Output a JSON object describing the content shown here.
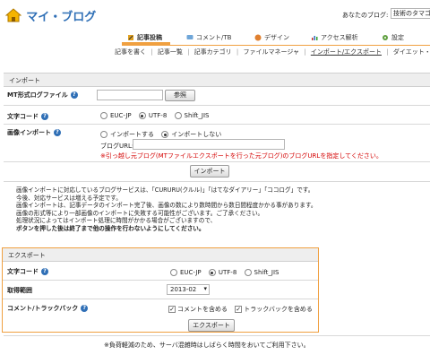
{
  "header": {
    "logo_text": "マイ・ブログ",
    "blog_label": "あなたのブログ:",
    "blog_select": "技術のタマゴ"
  },
  "top_nav": [
    {
      "label": "記事投稿",
      "icon": "pencil-icon"
    },
    {
      "label": "コメント/TB",
      "icon": "comment-icon"
    },
    {
      "label": "デザイン",
      "icon": "design-icon"
    },
    {
      "label": "アクセス解析",
      "icon": "chart-icon"
    },
    {
      "label": "設定",
      "icon": "settings-icon"
    }
  ],
  "sub_nav": [
    "記事を書く",
    "記事一覧",
    "記事カテゴリ",
    "ファイルマネージャ",
    "インポート/エクスポート",
    "ダイエット・ロ"
  ],
  "import": {
    "title": "インポート",
    "mt_label": "MT形式ログファイル",
    "browse_button": "参照",
    "charset_label": "文字コード",
    "charset_options": [
      "EUC-JP",
      "UTF-8",
      "Shift_JIS"
    ],
    "charset_selected": 1,
    "image_label": "画像インポート",
    "image_options": [
      "インポートする",
      "インポートしない"
    ],
    "image_selected": 1,
    "blog_url_label": "ブログURL:",
    "blog_url_note": "※引っ越し元ブログ(MTファイルエクスポートを行った元ブログ)のブログURLを指定してください。",
    "import_button": "インポート",
    "notes": [
      "画像インポートに対応しているブログサービスは、「CURURU(クルル)」「はてなダイアリー」「ココログ」です。",
      "今後、対応サービスは増える予定です。",
      "画像インポートは、記事データのインポート完了後、画像の数により数時間から数日間程度かかる事があります。",
      "画像の形式等により一部画像のインポートに失敗する可能性がございます。ご了承ください。",
      "処理状況によってはインポート処理に時間がかかる場合がございますので、",
      "ボタンを押した後は終了まで他の操作を行わないようにしてください。"
    ]
  },
  "export": {
    "title": "エクスポート",
    "charset_label": "文字コード",
    "charset_options": [
      "EUC-JP",
      "UTF-8",
      "Shift_JIS"
    ],
    "charset_selected": 1,
    "range_label": "取得範囲",
    "range_value": "2013-02",
    "comment_label": "コメント/トラックバック",
    "include_comments": "コメントを含める",
    "include_trackbacks": "トラックバックを含める",
    "export_button": "エクスポート",
    "footnote": "※負荷軽減のため、サーバ混雑時はしばらく時間をおいてご利用下さい。"
  },
  "colors": {
    "accent_orange": "#f0a040",
    "brand_blue": "#2f6fb6",
    "warning_red": "#d40000",
    "section_bg": "#eeeeee"
  }
}
